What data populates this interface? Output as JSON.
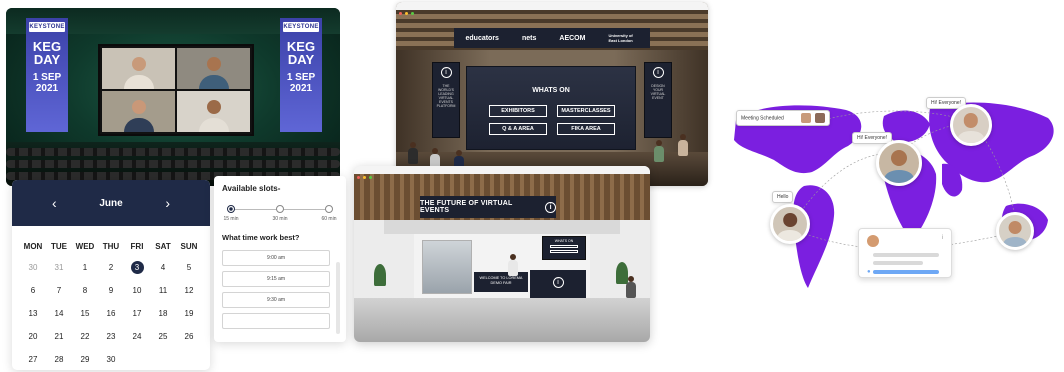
{
  "auditorium": {
    "banner_left": {
      "brand": "KEYSTONE",
      "title": "KEG DAY",
      "date": "1 SEP 2021"
    },
    "banner_right": {
      "brand": "KEYSTONE",
      "title": "KEG DAY",
      "date": "1 SEP 2021"
    }
  },
  "calendar": {
    "month": "June",
    "prev_icon": "‹",
    "next_icon": "›",
    "weekdays": [
      "MON",
      "TUE",
      "WED",
      "THU",
      "FRI",
      "SAT",
      "SUN"
    ],
    "days": [
      {
        "n": "30",
        "muted": true
      },
      {
        "n": "31",
        "muted": true
      },
      {
        "n": "1"
      },
      {
        "n": "2"
      },
      {
        "n": "3",
        "selected": true
      },
      {
        "n": "4"
      },
      {
        "n": "5"
      },
      {
        "n": "6"
      },
      {
        "n": "7"
      },
      {
        "n": "8"
      },
      {
        "n": "9"
      },
      {
        "n": "10"
      },
      {
        "n": "11"
      },
      {
        "n": "12"
      },
      {
        "n": "13"
      },
      {
        "n": "14"
      },
      {
        "n": "15"
      },
      {
        "n": "16"
      },
      {
        "n": "17"
      },
      {
        "n": "18"
      },
      {
        "n": "19"
      },
      {
        "n": "20"
      },
      {
        "n": "21"
      },
      {
        "n": "22"
      },
      {
        "n": "23"
      },
      {
        "n": "24"
      },
      {
        "n": "25"
      },
      {
        "n": "26"
      },
      {
        "n": "27"
      },
      {
        "n": "28"
      },
      {
        "n": "29"
      },
      {
        "n": "30"
      }
    ],
    "accent": "#1f2a47"
  },
  "slots": {
    "title": "Available slots-",
    "durations": [
      {
        "label": "15 min",
        "selected": true
      },
      {
        "label": "30 min",
        "selected": false
      },
      {
        "label": "60 min",
        "selected": false
      }
    ],
    "question": "What time work best?",
    "times": [
      "9:00 am",
      "9:15 am",
      "9:30 am",
      ""
    ]
  },
  "expo": {
    "sponsors": [
      "educators",
      "nets",
      "AECOM",
      "University of East London"
    ],
    "heading": "WHATS ON",
    "buttons": [
      "EXHIBITORS",
      "MASTERCLASSES",
      "Q & A AREA",
      "FIKA AREA"
    ],
    "pillar_left_text": "THE WORLD'S LEADING VIRTUAL EVENTS PLATFORM",
    "pillar_right_text": "DESIGN YOUR VIRTUAL EVENT"
  },
  "lobby": {
    "heading": "THE FUTURE OF VIRTUAL EVENTS",
    "screen_title": "WHATS ON",
    "desk_text": "WELCOME TO LOREMA DEMO FAIR"
  },
  "map": {
    "meeting_label": "Meeting Scheduled",
    "hey_top": "Hi! Everyone!",
    "hey_mid": "Hi! Everyone!",
    "hello": "Hello",
    "land_color": "#7b1fe0",
    "progress_color": "#6ea8f5"
  }
}
